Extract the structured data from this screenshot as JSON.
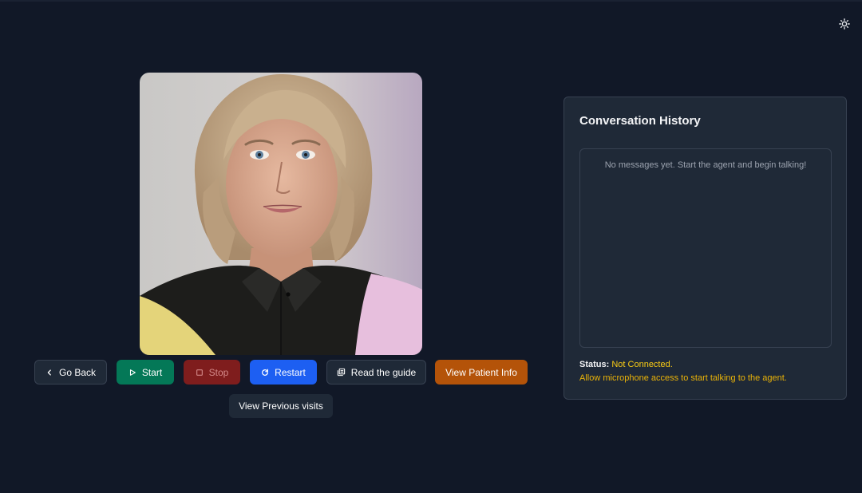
{
  "theme": {
    "icon": "sun-icon"
  },
  "avatar": {
    "description_icon": "avatar-portrait"
  },
  "controls": {
    "go_back": {
      "label": "Go Back",
      "icon": "chevron-left-icon"
    },
    "start": {
      "label": "Start",
      "icon": "play-icon"
    },
    "stop": {
      "label": "Stop",
      "icon": "square-icon"
    },
    "restart": {
      "label": "Restart",
      "icon": "rotate-icon"
    },
    "read_guide": {
      "label": "Read the guide",
      "icon": "book-icon"
    },
    "view_patient_info": {
      "label": "View Patient Info"
    },
    "view_previous_visits": {
      "label": "View Previous visits"
    }
  },
  "conversation": {
    "title": "Conversation History",
    "empty_message": "No messages yet. Start the agent and begin talking!",
    "status_label": "Status:",
    "status_value": "Not Connected.",
    "hint": "Allow microphone access to start talking to the agent."
  },
  "colors": {
    "background": "#111827",
    "panel": "#1f2937",
    "start": "#047857",
    "stop": "#7f1d1d",
    "restart": "#1d5ff2",
    "patient_info": "#b45309",
    "status_warning": "#facc15"
  }
}
